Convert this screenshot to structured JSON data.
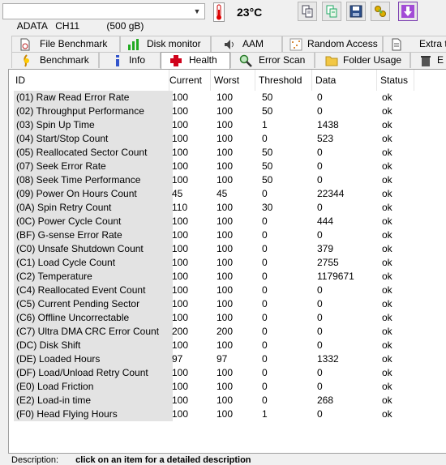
{
  "toolbar": {
    "drive": "ADATA   CH11          (500 gB)",
    "temperature": "23°C",
    "icons": [
      "copy-icon",
      "copy-export-icon",
      "save-icon",
      "options-icon",
      "download-icon"
    ]
  },
  "tabs_top": [
    {
      "label": "File Benchmark",
      "icon": "file-benchmark-icon"
    },
    {
      "label": "Disk monitor",
      "icon": "disk-monitor-icon"
    },
    {
      "label": "AAM",
      "icon": "speaker-icon"
    },
    {
      "label": "Random Access",
      "icon": "random-access-icon"
    },
    {
      "label": "Extra te",
      "icon": "extra-tests-icon"
    }
  ],
  "tabs_bottom": [
    {
      "label": "Benchmark",
      "icon": "benchmark-icon"
    },
    {
      "label": "Info",
      "icon": "info-icon"
    },
    {
      "label": "Health",
      "icon": "health-cross-icon",
      "active": true
    },
    {
      "label": "Error Scan",
      "icon": "magnifier-icon"
    },
    {
      "label": "Folder Usage",
      "icon": "folder-icon"
    },
    {
      "label": "E",
      "icon": "erase-icon"
    }
  ],
  "columns": {
    "id": "ID",
    "current": "Current",
    "worst": "Worst",
    "threshold": "Threshold",
    "data": "Data",
    "status": "Status"
  },
  "rows": [
    {
      "id": "(01) Raw Read Error Rate",
      "current": "100",
      "worst": "100",
      "threshold": "50",
      "data": "0",
      "status": "ok"
    },
    {
      "id": "(02) Throughput Performance",
      "current": "100",
      "worst": "100",
      "threshold": "50",
      "data": "0",
      "status": "ok"
    },
    {
      "id": "(03) Spin Up Time",
      "current": "100",
      "worst": "100",
      "threshold": "1",
      "data": "1438",
      "status": "ok"
    },
    {
      "id": "(04) Start/Stop Count",
      "current": "100",
      "worst": "100",
      "threshold": "0",
      "data": "523",
      "status": "ok"
    },
    {
      "id": "(05) Reallocated Sector Count",
      "current": "100",
      "worst": "100",
      "threshold": "50",
      "data": "0",
      "status": "ok"
    },
    {
      "id": "(07) Seek Error Rate",
      "current": "100",
      "worst": "100",
      "threshold": "50",
      "data": "0",
      "status": "ok"
    },
    {
      "id": "(08) Seek Time Performance",
      "current": "100",
      "worst": "100",
      "threshold": "50",
      "data": "0",
      "status": "ok"
    },
    {
      "id": "(09) Power On Hours Count",
      "current": "45",
      "worst": "45",
      "threshold": "0",
      "data": "22344",
      "status": "ok"
    },
    {
      "id": "(0A) Spin Retry Count",
      "current": "110",
      "worst": "100",
      "threshold": "30",
      "data": "0",
      "status": "ok"
    },
    {
      "id": "(0C) Power Cycle Count",
      "current": "100",
      "worst": "100",
      "threshold": "0",
      "data": "444",
      "status": "ok"
    },
    {
      "id": "(BF) G-sense Error Rate",
      "current": "100",
      "worst": "100",
      "threshold": "0",
      "data": "0",
      "status": "ok"
    },
    {
      "id": "(C0) Unsafe Shutdown Count",
      "current": "100",
      "worst": "100",
      "threshold": "0",
      "data": "379",
      "status": "ok"
    },
    {
      "id": "(C1) Load Cycle Count",
      "current": "100",
      "worst": "100",
      "threshold": "0",
      "data": "2755",
      "status": "ok"
    },
    {
      "id": "(C2) Temperature",
      "current": "100",
      "worst": "100",
      "threshold": "0",
      "data": "1179671",
      "status": "ok"
    },
    {
      "id": "(C4) Reallocated Event Count",
      "current": "100",
      "worst": "100",
      "threshold": "0",
      "data": "0",
      "status": "ok"
    },
    {
      "id": "(C5) Current Pending Sector",
      "current": "100",
      "worst": "100",
      "threshold": "0",
      "data": "0",
      "status": "ok"
    },
    {
      "id": "(C6) Offline Uncorrectable",
      "current": "100",
      "worst": "100",
      "threshold": "0",
      "data": "0",
      "status": "ok"
    },
    {
      "id": "(C7) Ultra DMA CRC Error Count",
      "current": "200",
      "worst": "200",
      "threshold": "0",
      "data": "0",
      "status": "ok"
    },
    {
      "id": "(DC) Disk Shift",
      "current": "100",
      "worst": "100",
      "threshold": "0",
      "data": "0",
      "status": "ok"
    },
    {
      "id": "(DE) Loaded Hours",
      "current": "97",
      "worst": "97",
      "threshold": "0",
      "data": "1332",
      "status": "ok"
    },
    {
      "id": "(DF) Load/Unload Retry Count",
      "current": "100",
      "worst": "100",
      "threshold": "0",
      "data": "0",
      "status": "ok"
    },
    {
      "id": "(E0) Load Friction",
      "current": "100",
      "worst": "100",
      "threshold": "0",
      "data": "0",
      "status": "ok"
    },
    {
      "id": "(E2) Load-in time",
      "current": "100",
      "worst": "100",
      "threshold": "0",
      "data": "268",
      "status": "ok"
    },
    {
      "id": "(F0) Head Flying Hours",
      "current": "100",
      "worst": "100",
      "threshold": "1",
      "data": "0",
      "status": "ok"
    }
  ],
  "description": {
    "label": "Description:",
    "text": "click on an item for a detailed description"
  },
  "colors": {
    "cell_gray": "#e3e3e3",
    "health_cross": "#d0021b",
    "download_purple": "#a24bd6"
  }
}
